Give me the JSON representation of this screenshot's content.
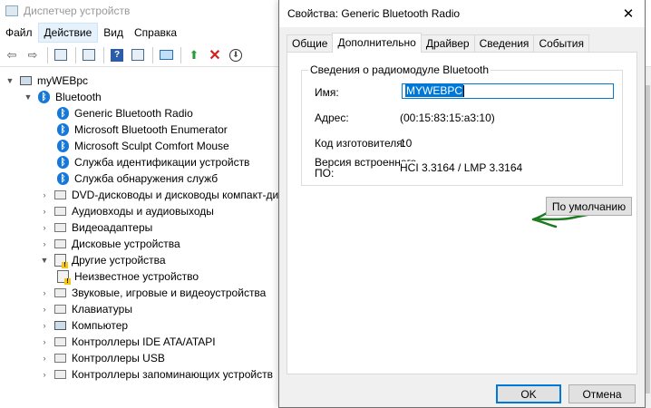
{
  "devmgr": {
    "title": "Диспетчер устройств",
    "menu": [
      {
        "label": "Файл"
      },
      {
        "label": "Действие"
      },
      {
        "label": "Вид"
      },
      {
        "label": "Справка"
      }
    ],
    "tree": {
      "root": "myWEBpc",
      "bluetooth": "Bluetooth",
      "bluetooth_children": [
        "Generic Bluetooth Radio",
        "Microsoft Bluetooth Enumerator",
        "Microsoft Sculpt Comfort Mouse",
        "Служба идентификации устройств",
        "Служба обнаружения служб"
      ],
      "categories": [
        "DVD-дисководы и дисководы компакт-дисков",
        "Аудиовходы и аудиовыходы",
        "Видеоадаптеры",
        "Дисковые устройства",
        "Другие устройства"
      ],
      "unknown_device": "Неизвестное устройство",
      "categories2": [
        "Звуковые, игровые и видеоустройства",
        "Клавиатуры",
        "Компьютер",
        "Контроллеры IDE ATA/ATAPI",
        "Контроллеры USB",
        "Контроллеры запоминающих устройств"
      ]
    }
  },
  "dialog": {
    "title": "Свойства: Generic Bluetooth Radio",
    "tabs": [
      {
        "label": "Общие"
      },
      {
        "label": "Дополнительно"
      },
      {
        "label": "Драйвер"
      },
      {
        "label": "Сведения"
      },
      {
        "label": "События"
      }
    ],
    "group_title": "Сведения о радиомодуле Bluetooth",
    "name_label": "Имя:",
    "name_value": "MYWEBPC",
    "address_label": "Адрес:",
    "address_value": "(00:15:83:15:a3:10)",
    "manufacturer_label": "Код изготовителя:",
    "manufacturer_value": "10",
    "firmware_label_line1": "Версия встроенного",
    "firmware_label_line2": "ПО:",
    "firmware_value": "HCI 3.3164  /  LMP 3.3164",
    "default_button": "По умолчанию",
    "ok_button": "OK",
    "cancel_button": "Отмена"
  },
  "colors": {
    "accent": "#0078d7",
    "bluetooth_icon": "#1878d8",
    "annotation": "#1e7a1e"
  }
}
